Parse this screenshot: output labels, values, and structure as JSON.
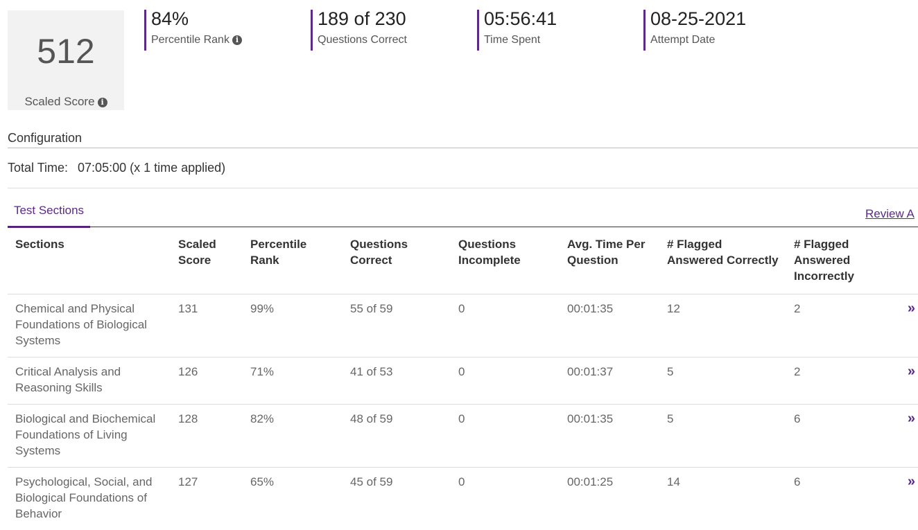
{
  "summary": {
    "scaled_score": "512",
    "scaled_score_label": "Scaled Score",
    "percentile_value": "84%",
    "percentile_label": "Percentile Rank",
    "questions_value": "189 of 230",
    "questions_label": "Questions Correct",
    "time_value": "05:56:41",
    "time_label": "Time Spent",
    "date_value": "08-25-2021",
    "date_label": "Attempt Date"
  },
  "configuration": {
    "title": "Configuration",
    "total_time_label": "Total Time:",
    "total_time_value": "07:05:00 (x 1 time applied)"
  },
  "tabs": {
    "active": "Test Sections",
    "review_link": "Review A"
  },
  "table": {
    "headers": [
      "Sections",
      "Scaled Score",
      "Percentile Rank",
      "Questions Correct",
      "Questions Incomplete",
      "Avg. Time Per Question",
      "# Flagged Answered Correctly",
      "# Flagged Answered Incorrectly"
    ],
    "rows": [
      {
        "section": "Chemical and Physical Foundations of Biological Systems",
        "scaled": "131",
        "percentile": "99%",
        "correct": "55 of 59",
        "incomplete": "0",
        "avg_time": "00:01:35",
        "flag_correct": "12",
        "flag_incorrect": "2"
      },
      {
        "section": "Critical Analysis and Reasoning Skills",
        "scaled": "126",
        "percentile": "71%",
        "correct": "41 of 53",
        "incomplete": "0",
        "avg_time": "00:01:37",
        "flag_correct": "5",
        "flag_incorrect": "2"
      },
      {
        "section": "Biological and Biochemical Foundations of Living Systems",
        "scaled": "128",
        "percentile": "82%",
        "correct": "48 of 59",
        "incomplete": "0",
        "avg_time": "00:01:35",
        "flag_correct": "5",
        "flag_incorrect": "6"
      },
      {
        "section": "Psychological, Social, and Biological Foundations of Behavior",
        "scaled": "127",
        "percentile": "65%",
        "correct": "45 of 59",
        "incomplete": "0",
        "avg_time": "00:01:25",
        "flag_correct": "14",
        "flag_incorrect": "6"
      }
    ]
  },
  "colors": {
    "accent": "#5b2a86"
  },
  "icons": {
    "info": "info-circle-icon",
    "row_action": "double-chevron-right-icon"
  }
}
